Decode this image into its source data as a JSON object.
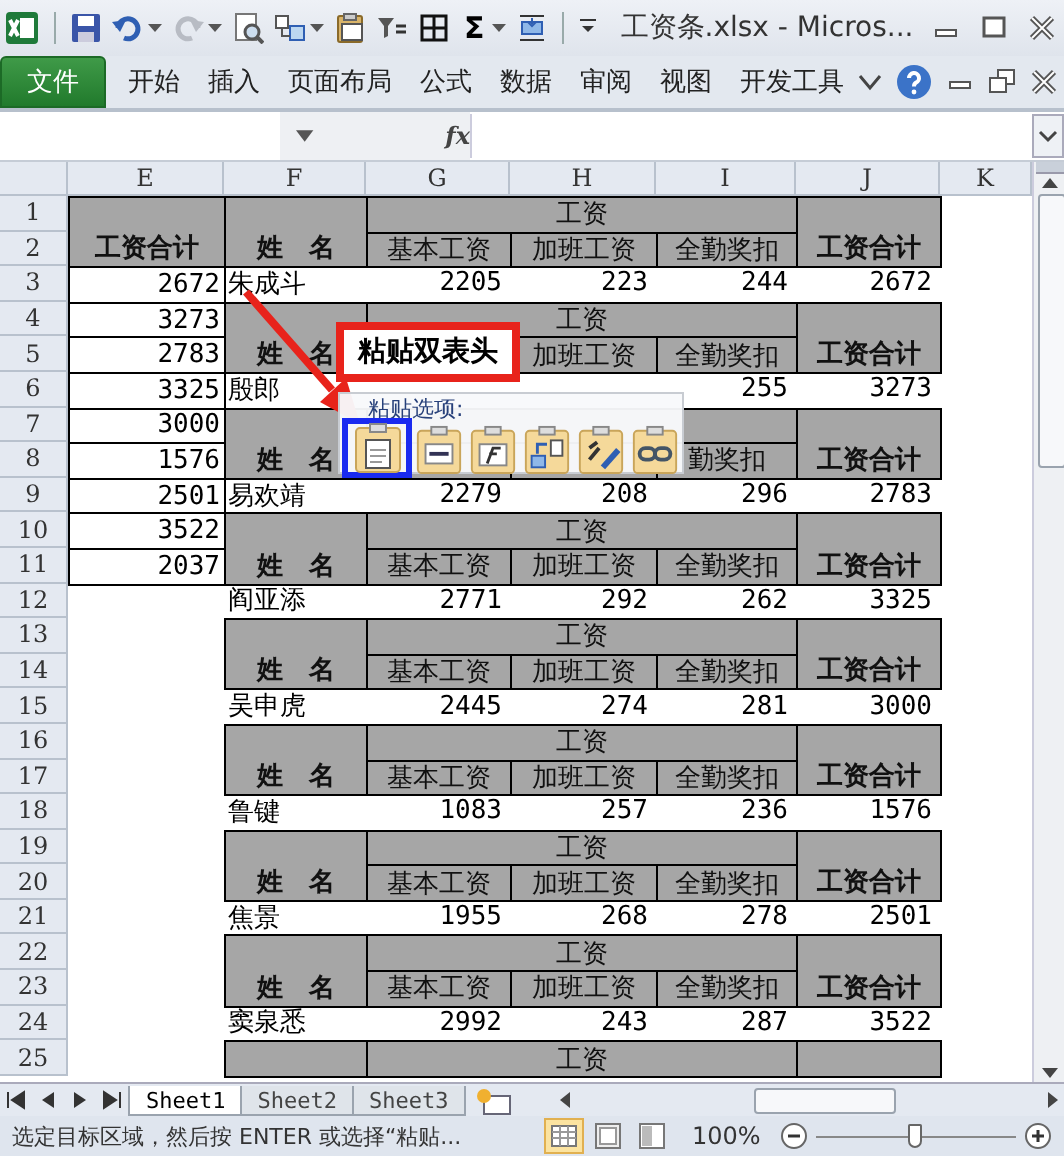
{
  "window": {
    "title": "工资条.xlsx  -  Micros...",
    "quick_access": [
      {
        "kind": "save"
      },
      {
        "kind": "undo"
      },
      {
        "kind": "dropdown"
      },
      {
        "kind": "redo"
      },
      {
        "kind": "dropdown"
      },
      {
        "kind": "preview"
      },
      {
        "kind": "layout"
      },
      {
        "kind": "dropdown"
      },
      {
        "kind": "clipboard"
      },
      {
        "kind": "filter"
      },
      {
        "kind": "borders"
      },
      {
        "kind": "sum",
        "label": "Σ"
      },
      {
        "kind": "dropdown"
      },
      {
        "kind": "insert"
      },
      {
        "kind": "customize"
      }
    ]
  },
  "ribbon": {
    "file_tab": "文件",
    "tabs": [
      "开始",
      "插入",
      "页面布局",
      "公式",
      "数据",
      "审阅",
      "视图",
      "开发工具"
    ]
  },
  "formula_bar": {
    "function_label": "fx"
  },
  "sheet": {
    "column_headers": [
      "E",
      "F",
      "G",
      "H",
      "I",
      "J",
      "K"
    ],
    "row_numbers": [
      "1",
      "2",
      "3",
      "4",
      "5",
      "6",
      "7",
      "8",
      "9",
      "10",
      "11",
      "12",
      "13",
      "14",
      "15",
      "16",
      "17",
      "18",
      "19",
      "20",
      "21",
      "22",
      "23",
      "24",
      "25"
    ],
    "total_column": {
      "header": "工资合计",
      "values": [
        "2672",
        "3273",
        "2783",
        "3325",
        "3000",
        "1576",
        "2501",
        "3522",
        "2037"
      ]
    },
    "sections": [
      {
        "kind": "header",
        "name_label": "姓　名",
        "group_label": "工资",
        "basic_label": "基本工资",
        "overtime_label": "加班工资",
        "attendance_label": "全勤奖扣",
        "total_label": "工资合计"
      },
      {
        "kind": "data",
        "name": "朱成斗",
        "basic": "2205",
        "overtime": "223",
        "attendance": "244",
        "total": "2672"
      },
      {
        "kind": "header",
        "name_label": "姓　名",
        "group_label": "工资",
        "overtime_label": "加班工资",
        "attendance_label": "全勤奖扣",
        "total_label": "工资合计"
      },
      {
        "kind": "data",
        "name": "殷郎",
        "attendance": "255",
        "total": "3273"
      },
      {
        "kind": "header",
        "name_label": "姓　名",
        "attendance_label": "勤奖扣",
        "total_label": "工资合计"
      },
      {
        "kind": "data",
        "name": "易欢靖",
        "basic": "2279",
        "overtime": "208",
        "attendance": "296",
        "total": "2783"
      },
      {
        "kind": "header",
        "name_label": "姓　名",
        "group_label": "工资",
        "basic_label": "基本工资",
        "overtime_label": "加班工资",
        "attendance_label": "全勤奖扣",
        "total_label": "工资合计"
      },
      {
        "kind": "data",
        "name": "阎亚添",
        "basic": "2771",
        "overtime": "292",
        "attendance": "262",
        "total": "3325"
      },
      {
        "kind": "header",
        "name_label": "姓　名",
        "group_label": "工资",
        "basic_label": "基本工资",
        "overtime_label": "加班工资",
        "attendance_label": "全勤奖扣",
        "total_label": "工资合计"
      },
      {
        "kind": "data",
        "name": "吴申虎",
        "basic": "2445",
        "overtime": "274",
        "attendance": "281",
        "total": "3000"
      },
      {
        "kind": "header",
        "name_label": "姓　名",
        "group_label": "工资",
        "basic_label": "基本工资",
        "overtime_label": "加班工资",
        "attendance_label": "全勤奖扣",
        "total_label": "工资合计"
      },
      {
        "kind": "data",
        "name": "鲁键",
        "basic": "1083",
        "overtime": "257",
        "attendance": "236",
        "total": "1576"
      },
      {
        "kind": "header",
        "name_label": "姓　名",
        "group_label": "工资",
        "basic_label": "基本工资",
        "overtime_label": "加班工资",
        "attendance_label": "全勤奖扣",
        "total_label": "工资合计"
      },
      {
        "kind": "data",
        "name": "焦景",
        "basic": "1955",
        "overtime": "268",
        "attendance": "278",
        "total": "2501"
      },
      {
        "kind": "header",
        "name_label": "姓　名",
        "group_label": "工资",
        "basic_label": "基本工资",
        "overtime_label": "加班工资",
        "attendance_label": "全勤奖扣",
        "total_label": "工资合计"
      },
      {
        "kind": "data",
        "name": "窦泉悉",
        "basic": "2992",
        "overtime": "243",
        "attendance": "287",
        "total": "3522"
      },
      {
        "kind": "header_top",
        "group_label": "工资"
      }
    ]
  },
  "callout": {
    "text": "粘贴双表头"
  },
  "paste_options": {
    "label": "粘贴选项:",
    "options": [
      {
        "kind": "paste",
        "selected": true
      },
      {
        "kind": "values",
        "selected": false
      },
      {
        "kind": "formulas",
        "selected": false
      },
      {
        "kind": "transpose",
        "selected": false
      },
      {
        "kind": "formatting",
        "selected": false
      },
      {
        "kind": "link",
        "selected": false
      }
    ]
  },
  "sheet_tabs": [
    {
      "label": "Sheet1",
      "selected": true
    },
    {
      "label": "Sheet2",
      "selected": false
    },
    {
      "label": "Sheet3",
      "selected": false
    }
  ],
  "status_bar": {
    "message": "选定目标区域，然后按 ENTER 或选择“粘贴...",
    "views": [
      {
        "kind": "normal",
        "selected": true
      },
      {
        "kind": "page_layout",
        "selected": false
      },
      {
        "kind": "page_break",
        "selected": false
      }
    ],
    "zoom": "100%",
    "zoom_slider": {
      "level": 0.5
    }
  }
}
